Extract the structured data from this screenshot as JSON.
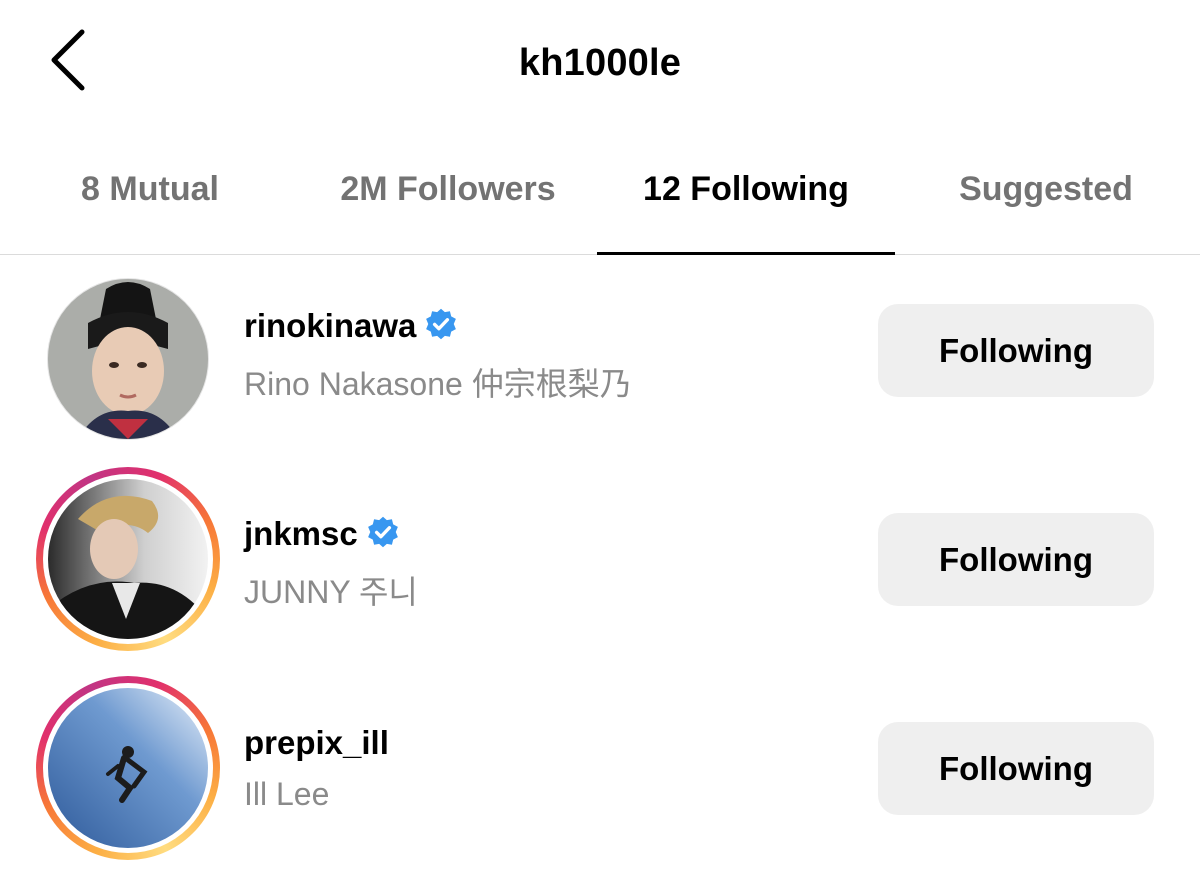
{
  "header": {
    "title": "kh1000le",
    "back_icon": "chevron-left-icon"
  },
  "tabs": [
    {
      "label": "8 Mutual",
      "active": false
    },
    {
      "label": "2M Followers",
      "active": false
    },
    {
      "label": "12 Following",
      "active": true
    },
    {
      "label": "Suggested",
      "active": false
    }
  ],
  "accounts": [
    {
      "username": "rinokinawa",
      "full_name": "Rino Nakasone 仲宗根梨乃",
      "verified": true,
      "has_story_ring": false,
      "button_label": "Following"
    },
    {
      "username": "jnkmsc",
      "full_name": "JUNNY 주니",
      "verified": true,
      "has_story_ring": true,
      "button_label": "Following"
    },
    {
      "username": "prepix_ill",
      "full_name": "Ill Lee",
      "verified": false,
      "has_story_ring": true,
      "button_label": "Following"
    }
  ],
  "colors": {
    "verified_badge": "#3897f0",
    "button_bg": "#efefef",
    "secondary_text": "#8a8a8a",
    "inactive_tab": "#737373"
  }
}
